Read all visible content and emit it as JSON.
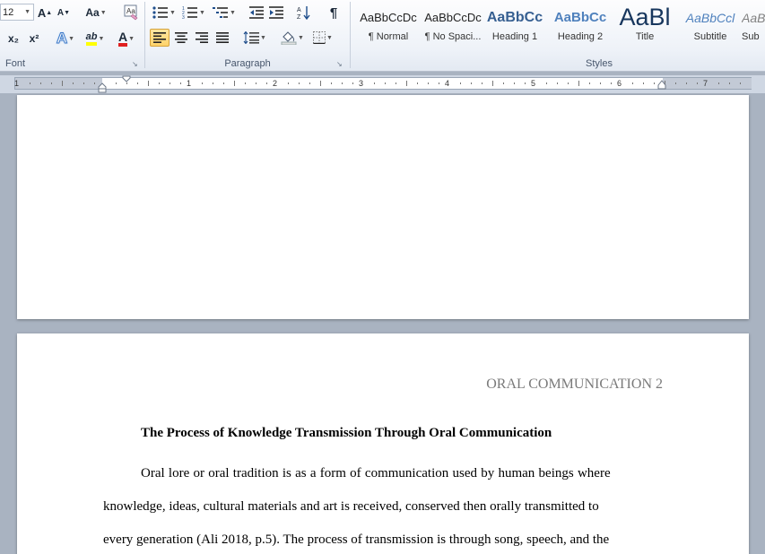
{
  "ribbon": {
    "font_group": {
      "label": "Font",
      "font_size": "12",
      "grow_font": "A",
      "shrink_font": "A",
      "change_case": "Aa",
      "subscript": "x₂",
      "superscript": "x²",
      "text_effects": "A",
      "highlight": "ab",
      "font_color": "A"
    },
    "paragraph_group": {
      "label": "Paragraph",
      "show_marks": "¶"
    },
    "styles_group": {
      "label": "Styles",
      "items": [
        {
          "sample": "AaBbCcDc",
          "name": "¶ Normal",
          "color": "#000000"
        },
        {
          "sample": "AaBbCcDc",
          "name": "¶ No Spaci...",
          "color": "#000000"
        },
        {
          "sample": "AaBbCc",
          "name": "Heading 1",
          "color": "#365f91"
        },
        {
          "sample": "AaBbCc",
          "name": "Heading 2",
          "color": "#4f81bd"
        },
        {
          "sample": "AaBl",
          "name": "Title",
          "color": "#17365d"
        },
        {
          "sample": "AaBbCcl",
          "name": "Subtitle",
          "color": "#4f81bd"
        },
        {
          "sample": "AaBl",
          "name": "Sub",
          "color": "#808080"
        }
      ]
    }
  },
  "ruler": {
    "numbers": [
      "1",
      "1",
      "2",
      "3",
      "4",
      "5",
      "6",
      "7"
    ]
  },
  "document": {
    "page2": {
      "header": "ORAL COMMUNICATION 2",
      "title": "The Process of Knowledge Transmission  Through Oral Communication",
      "lines": [
        "Oral lore or oral tradition is as a form of communication  used by human beings where",
        "knowledge, ideas, cultural materials  and art is received,  conserved then orally transmitted to",
        "every  generation (Ali 2018, p.5). The process of transmission  is through song, speech,  and the"
      ]
    }
  },
  "colors": {
    "accent_active": "#ffd36a",
    "ribbon_bg": "#eef2f8",
    "workspace_bg": "#a9b3c1"
  }
}
